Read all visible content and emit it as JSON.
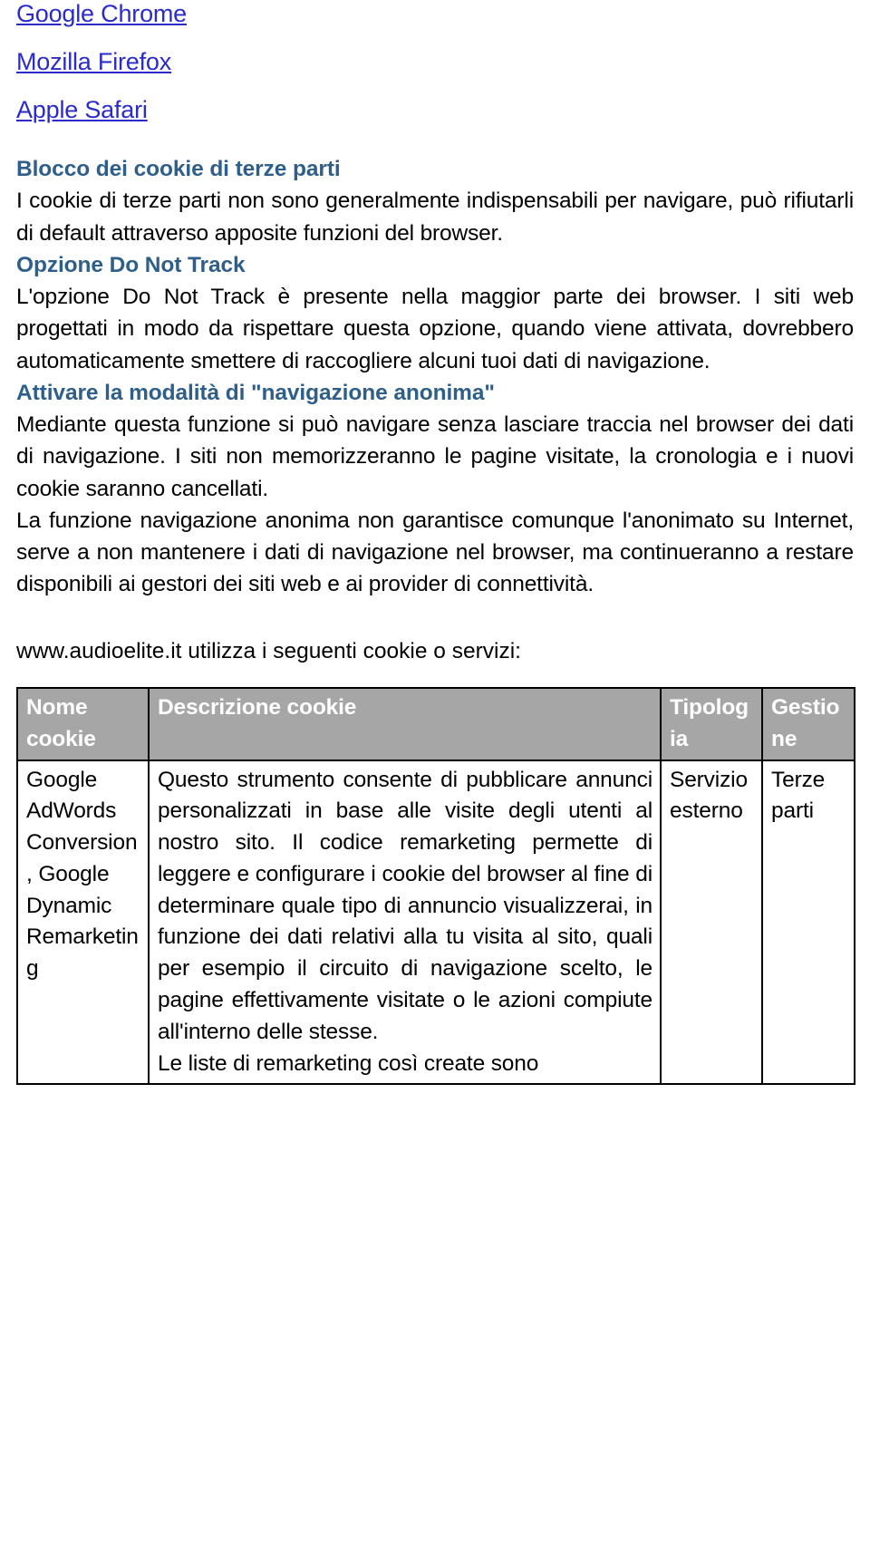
{
  "document": {
    "language": "it",
    "links": [
      {
        "label": "Google Chrome",
        "name": "link-google-chrome"
      },
      {
        "label": "Mozilla Firefox",
        "name": "link-mozilla-firefox"
      },
      {
        "label": "Apple Safari",
        "name": "link-apple-safari"
      }
    ],
    "sections": [
      {
        "heading": "Blocco dei cookie di terze parti",
        "paragraph": "I cookie di terze parti non sono generalmente indispensabili per navigare, può rifiutarli di default attraverso apposite funzioni del browser."
      },
      {
        "heading": "Opzione Do Not Track",
        "paragraph": "L'opzione Do Not Track è presente nella maggior parte dei browser. I siti web progettati in modo da rispettare questa opzione, quando viene attivata, dovrebbero automaticamente smettere di raccogliere alcuni tuoi dati di navigazione."
      },
      {
        "heading": "Attivare la modalità di \"navigazione anonima\"",
        "paragraph": "Mediante questa funzione si può navigare senza lasciare traccia nel browser dei dati di navigazione. I siti non memorizzeranno le pagine visitate, la cronologia e i nuovi cookie saranno cancellati."
      }
    ],
    "closing_paragraph": "La funzione navigazione anonima non garantisce comunque l'anonimato su Internet, serve a non mantenere i dati di navigazione nel browser, ma continueranno a restare disponibili ai gestori dei siti web e ai provider di connettività.",
    "table_intro": "www.audioelite.it utilizza i seguenti cookie o servizi:",
    "table": {
      "headers": [
        "Nome cookie",
        "Descrizione cookie",
        "Tipologia",
        "Gestione"
      ],
      "rows": [
        {
          "nome": "Google AdWords Conversion, Google Dynamic Remarketing",
          "descrizione_1": "Questo strumento consente di pubblicare annunci personalizzati in base alle visite degli utenti al nostro sito. Il codice remarketing permette di leggere e configurare i cookie del browser al fine di determinare quale tipo di annuncio visualizzerai, in funzione dei dati relativi alla tu visita al sito, quali per esempio il circuito di navigazione scelto, le pagine effettivamente visitate o le azioni compiute all'interno delle stesse.",
          "descrizione_2": "Le liste di remarketing così create sono",
          "tipologia": "Servizio esterno",
          "gestione": "Terze parti"
        }
      ]
    },
    "colors": {
      "link": "#2B2BCC",
      "heading": "#2E5F8A",
      "table_header_bg": "#A6A6A6",
      "table_header_text": "#FFFFFF",
      "table_border": "#000000",
      "body_text": "#000000",
      "page_bg": "#FFFFFF"
    }
  }
}
